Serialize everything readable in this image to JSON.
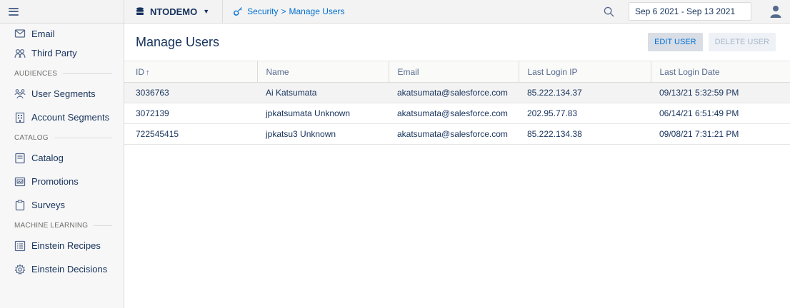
{
  "sidebar": {
    "items_top": [
      {
        "label": "Email",
        "icon": "mail-icon"
      },
      {
        "label": "Third Party",
        "icon": "handshake-icon"
      }
    ],
    "sections": [
      {
        "title": "AUDIENCES",
        "items": [
          {
            "label": "User Segments",
            "icon": "users-icon"
          },
          {
            "label": "Account Segments",
            "icon": "building-icon"
          }
        ]
      },
      {
        "title": "CATALOG",
        "items": [
          {
            "label": "Catalog",
            "icon": "catalog-icon"
          },
          {
            "label": "Promotions",
            "icon": "promotions-icon"
          },
          {
            "label": "Surveys",
            "icon": "clipboard-icon"
          }
        ]
      },
      {
        "title": "MACHINE LEARNING",
        "items": [
          {
            "label": "Einstein Recipes",
            "icon": "list-icon"
          },
          {
            "label": "Einstein Decisions",
            "icon": "gear-icon"
          }
        ]
      }
    ]
  },
  "topbar": {
    "org_name": "NTODEMO",
    "breadcrumb": {
      "parent": "Security",
      "separator": ">",
      "current": "Manage Users"
    },
    "date_range": "Sep 6 2021 - Sep 13 2021"
  },
  "main": {
    "title": "Manage Users",
    "edit_label": "EDIT USER",
    "delete_label": "DELETE USER",
    "columns": [
      "ID",
      "Name",
      "Email",
      "Last Login IP",
      "Last Login Date"
    ],
    "sort_indicator": "↑",
    "rows": [
      {
        "id": "3036763",
        "name": "Ai Katsumata",
        "email": "akatsumata@salesforce.com",
        "ip": "85.222.134.37",
        "date": "09/13/21 5:32:59 PM"
      },
      {
        "id": "3072139",
        "name": "jpkatsumata Unknown",
        "email": "akatsumata@salesforce.com",
        "ip": "202.95.77.83",
        "date": "06/14/21 6:51:49 PM"
      },
      {
        "id": "722545415",
        "name": "jpkatsu3 Unknown",
        "email": "akatsumata@salesforce.com",
        "ip": "85.222.134.38",
        "date": "09/08/21 7:31:21 PM"
      }
    ]
  },
  "colors": {
    "accent": "#0070d2",
    "text": "#16325c",
    "muted": "#54698d"
  }
}
